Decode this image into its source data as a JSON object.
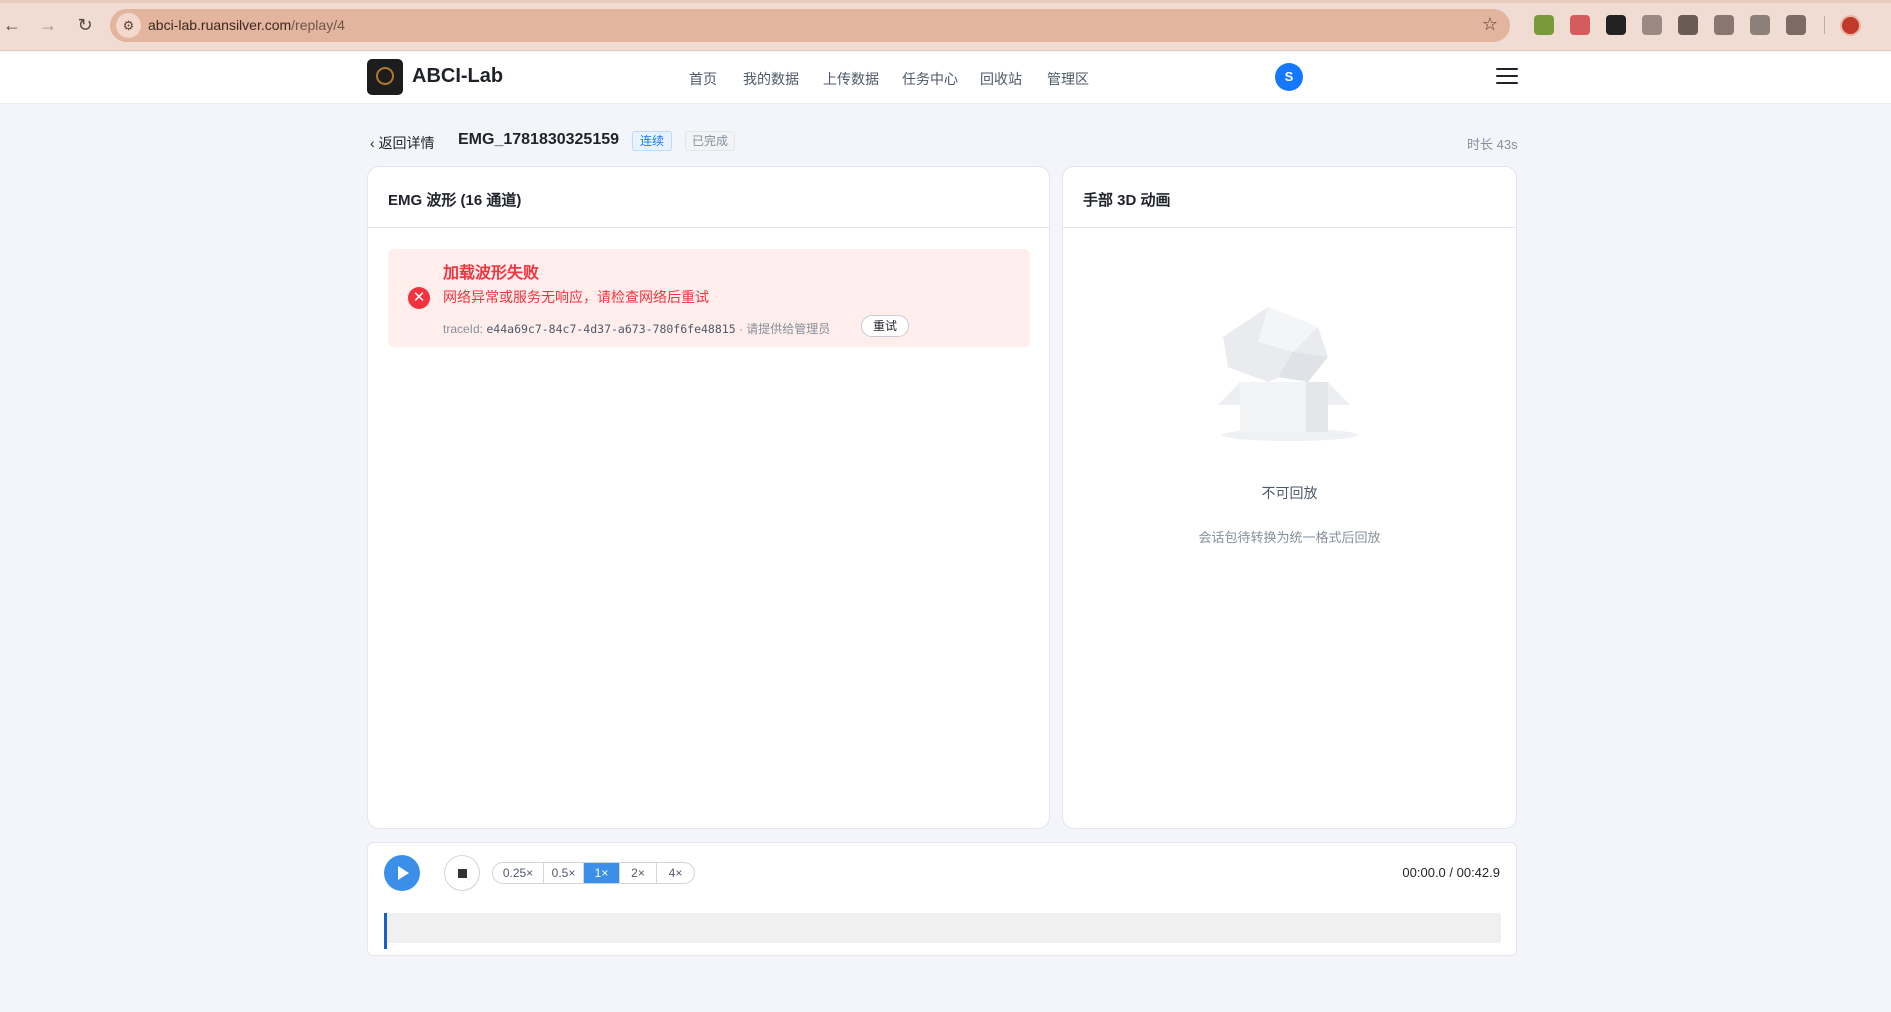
{
  "browser": {
    "url_host": "abci-lab.ruansilver.com",
    "url_path": "/replay/4"
  },
  "header": {
    "brand": "ABCI-Lab",
    "nav": [
      "首页",
      "我的数据",
      "上传数据",
      "任务中心",
      "回收站",
      "管理区"
    ],
    "avatar_initial": "S"
  },
  "session": {
    "back_label": "返回详情",
    "title": "EMG_1781830325159",
    "tag_mode": "连续",
    "tag_status": "已完成",
    "duration": "时长 43s"
  },
  "emg_panel": {
    "title": "EMG 波形 (16 通道)",
    "error": {
      "title": "加载波形失败",
      "description": "网络异常或服务无响应，请检查网络后重试",
      "trace_label": "traceId:",
      "trace_id": "e44a69c7-84c7-4d37-a673-780f6fe48815",
      "trace_hint": "· 请提供给管理员",
      "retry_label": "重试"
    }
  },
  "hand_panel": {
    "title": "手部 3D 动画",
    "empty_title": "不可回放",
    "empty_desc": "会话包待转换为统一格式后回放"
  },
  "player": {
    "speeds": [
      "0.25×",
      "0.5×",
      "1×",
      "2×",
      "4×"
    ],
    "active_speed_index": 2,
    "time": "00:00.0 / 00:42.9",
    "progress": 0
  },
  "colors": {
    "accent": "#3b8fe8",
    "error": "#f5333f",
    "browser_toolbar": "#f0dcd2",
    "omnibox": "#e3b49e"
  }
}
